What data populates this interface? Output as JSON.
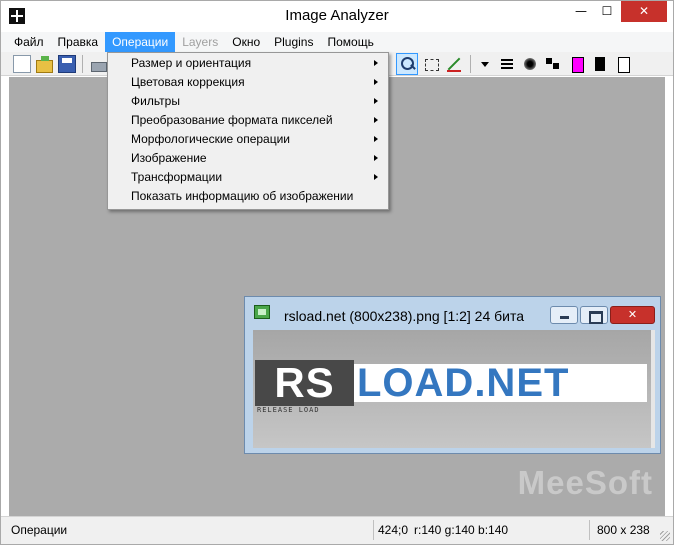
{
  "app": {
    "title": "Image Analyzer",
    "close_symbol": "✕",
    "min_symbol": "—",
    "max_symbol": "☐"
  },
  "menu": [
    {
      "label": "Файл"
    },
    {
      "label": "Правка"
    },
    {
      "label": "Операции",
      "active": true
    },
    {
      "label": "Layers",
      "disabled": true
    },
    {
      "label": "Окно"
    },
    {
      "label": "Plugins"
    },
    {
      "label": "Помощь"
    }
  ],
  "toolbar": {
    "icons": [
      "new-file-icon",
      "open-folder-icon",
      "save-icon",
      "scan-icon",
      "zoom-icon",
      "select-rectangle-icon",
      "pen-icon",
      "dropdown-arrow-icon",
      "line-width-icon",
      "soft-brush-icon",
      "dots-brush-icon",
      "magenta-color-icon",
      "black-color-icon",
      "white-color-icon"
    ],
    "colors": {
      "magenta": "#ff00ff",
      "black": "#000000",
      "white": "#ffffff"
    }
  },
  "operations_menu": {
    "items": [
      {
        "label": "Размер и ориентация",
        "submenu": true
      },
      {
        "label": "Цветовая коррекция",
        "submenu": true
      },
      {
        "label": "Фильтры",
        "submenu": true
      },
      {
        "label": "Преобразование формата пикселей",
        "submenu": true
      },
      {
        "label": "Морфологические операции",
        "submenu": true
      },
      {
        "label": "Изображение",
        "submenu": true
      },
      {
        "label": "Трансформации",
        "submenu": true
      },
      {
        "label": "Показать информацию об изображении",
        "submenu": false
      }
    ]
  },
  "image_window": {
    "title": "rsload.net (800x238).png [1:2] 24 бита",
    "close_symbol": "✕",
    "logo": {
      "rs": "RS",
      "load": "LOAD.NET",
      "sub": "RELEASE LOAD"
    }
  },
  "watermark": "MeeSoft",
  "statusbar": {
    "text": "Операции",
    "coords": "424;0",
    "pixel": "r:140 g:140 b:140",
    "size": "800 x 238"
  },
  "colors": {
    "accent": "#3399ff",
    "workspace": "#ababab",
    "close_button": "#c7312b",
    "logo_blue": "#3477c0"
  }
}
